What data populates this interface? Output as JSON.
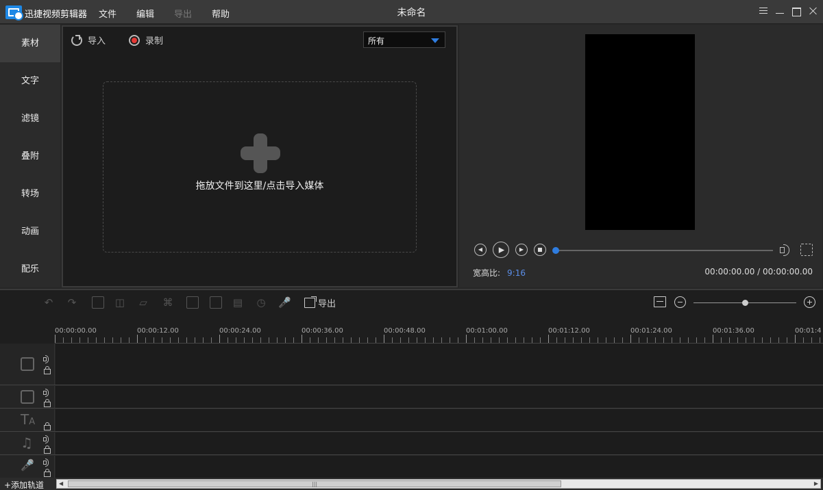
{
  "app": {
    "name": "迅捷视频剪辑器",
    "window_title": "未命名",
    "menu": [
      {
        "label": "文件",
        "enabled": true
      },
      {
        "label": "编辑",
        "enabled": true
      },
      {
        "label": "导出",
        "enabled": false
      },
      {
        "label": "帮助",
        "enabled": true
      }
    ]
  },
  "sidebar": {
    "items": [
      {
        "label": "素材",
        "active": true
      },
      {
        "label": "文字"
      },
      {
        "label": "滤镜"
      },
      {
        "label": "叠附"
      },
      {
        "label": "转场"
      },
      {
        "label": "动画"
      },
      {
        "label": "配乐"
      }
    ]
  },
  "media": {
    "import_label": "导入",
    "record_label": "录制",
    "filter_value": "所有",
    "drop_text": "拖放文件到这里/点击导入媒体"
  },
  "preview": {
    "ratio_label": "宽高比:",
    "ratio_value": "9:16",
    "timecode": "00:00:00.00 / 00:00:00.00",
    "progress": 0
  },
  "timeline": {
    "export_label": "导出",
    "zoom_level": 0.5,
    "ruler_labels": [
      "00:00:00.00",
      "00:00:12.00",
      "00:00:24.00",
      "00:00:36.00",
      "00:00:48.00",
      "00:01:00.00",
      "00:01:12.00",
      "00:01:24.00",
      "00:01:36.00",
      "00:01:4"
    ],
    "tracks": [
      {
        "name": "video-main",
        "icon": "film-icon",
        "has_sound": true,
        "has_lock": true
      },
      {
        "name": "video-overlay",
        "icon": "film-strip-icon",
        "has_sound": true,
        "has_lock": true
      },
      {
        "name": "text",
        "icon": "text-icon",
        "has_sound": false,
        "has_lock": true
      },
      {
        "name": "music",
        "icon": "music-note-icon",
        "has_sound": true,
        "has_lock": true
      },
      {
        "name": "voice",
        "icon": "microphone-icon",
        "has_sound": true,
        "has_lock": true
      }
    ]
  },
  "footer": {
    "add_track_label": "+添加轨道"
  }
}
